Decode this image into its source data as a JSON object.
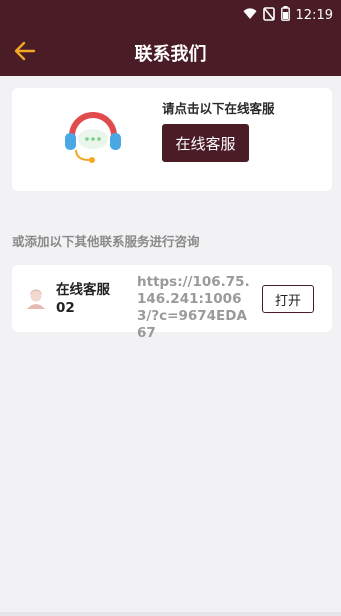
{
  "status_bar": {
    "time": "12:19",
    "icons": [
      "wifi-icon",
      "no-sim-icon",
      "battery-icon"
    ]
  },
  "header": {
    "title": "联系我们",
    "back_icon": "arrow-left-icon"
  },
  "online_card": {
    "prompt": "请点击以下在线客服",
    "button_label": "在线客服",
    "icon": "headset-icon"
  },
  "other_section": {
    "label": "或添加以下其他联系服务进行咨询",
    "items": [
      {
        "name": "在线客服02",
        "url": "https://106.75.146.241:10063/?c=9674EDA67",
        "action_label": "打开",
        "icon": "agent-avatar-icon"
      }
    ]
  },
  "colors": {
    "brand": "#4a1c26",
    "back_arrow": "#f5a623",
    "background": "#f2f2f4"
  }
}
